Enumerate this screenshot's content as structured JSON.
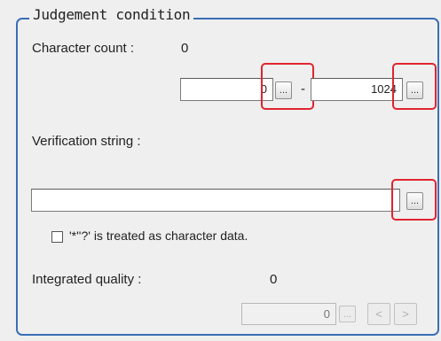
{
  "group": {
    "title": "Judgement condition"
  },
  "character_count": {
    "label": "Character count :",
    "value": "0",
    "min_value": "0",
    "max_value": "1024",
    "range_separator": "-",
    "min_button_label": "...",
    "max_button_label": "..."
  },
  "verification_string": {
    "label": "Verification string :",
    "value": "",
    "button_label": "..."
  },
  "wildcard_option": {
    "label": "'*''?' is treated as character data.",
    "checked": false
  },
  "integrated_quality": {
    "label": "Integrated quality :",
    "value": "0",
    "field_value": "0",
    "button_label": "...",
    "prev_label": "<",
    "next_label": ">"
  },
  "colors": {
    "frame": "#3a6fb5",
    "highlight": "#e0242f",
    "background": "#efefef"
  }
}
